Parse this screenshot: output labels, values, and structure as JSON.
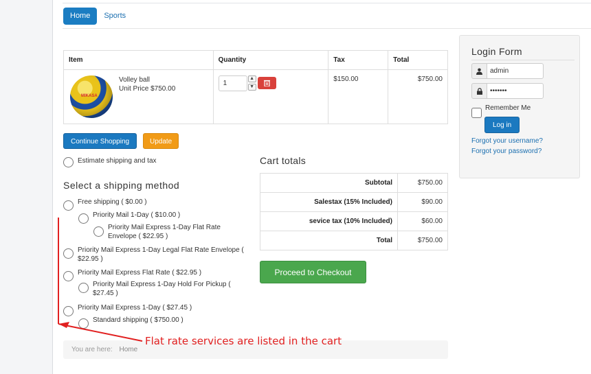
{
  "nav": {
    "home": "Home",
    "sports": "Sports"
  },
  "cart_table": {
    "headers": {
      "item": "Item",
      "quantity": "Quantity",
      "tax": "Tax",
      "total": "Total"
    },
    "row": {
      "name": "Volley ball",
      "unit_price": "Unit Price $750.00",
      "quantity": "1",
      "tax": "$150.00",
      "total": "$750.00",
      "ball_text": "MIKASA"
    }
  },
  "buttons": {
    "continue": "Continue Shopping",
    "update": "Update",
    "checkout": "Proceed to Checkout"
  },
  "estimate": {
    "label": "Estimate shipping and tax"
  },
  "shipping": {
    "title": "Select a shipping method",
    "options": [
      "Free shipping ( $0.00 )",
      "Priority Mail 1-Day ( $10.00 )",
      "Priority Mail Express 1-Day Flat Rate Envelope ( $22.95 )",
      "Priority Mail Express 1-Day Legal Flat Rate Envelope ( $22.95 )",
      "Priority Mail Express Flat Rate ( $22.95 )",
      "Priority Mail Express 1-Day Hold For Pickup ( $27.45 )",
      "Priority Mail Express 1-Day ( $27.45 )",
      "Standard shipping ( $750.00 )"
    ]
  },
  "totals": {
    "title": "Cart totals",
    "rows": [
      {
        "label": "Subtotal",
        "value": "$750.00"
      },
      {
        "label": "Salestax (15% Included)",
        "value": "$90.00"
      },
      {
        "label": "sevice tax (10% Included)",
        "value": "$60.00"
      },
      {
        "label": "Total",
        "value": "$750.00"
      }
    ]
  },
  "login": {
    "title": "Login Form",
    "username": "admin",
    "password": "•••••••",
    "remember": "Remember Me",
    "button": "Log in",
    "forgot_username": "Forgot your username?",
    "forgot_password": "Forgot your password?"
  },
  "breadcrumb": {
    "prefix": "You are here:",
    "home": "Home"
  },
  "annotation": {
    "text": "Flat rate services are listed in the cart",
    "color": "#e12020"
  },
  "icons": {
    "user": "user-icon",
    "lock": "lock-icon",
    "trash": "trash-icon"
  }
}
